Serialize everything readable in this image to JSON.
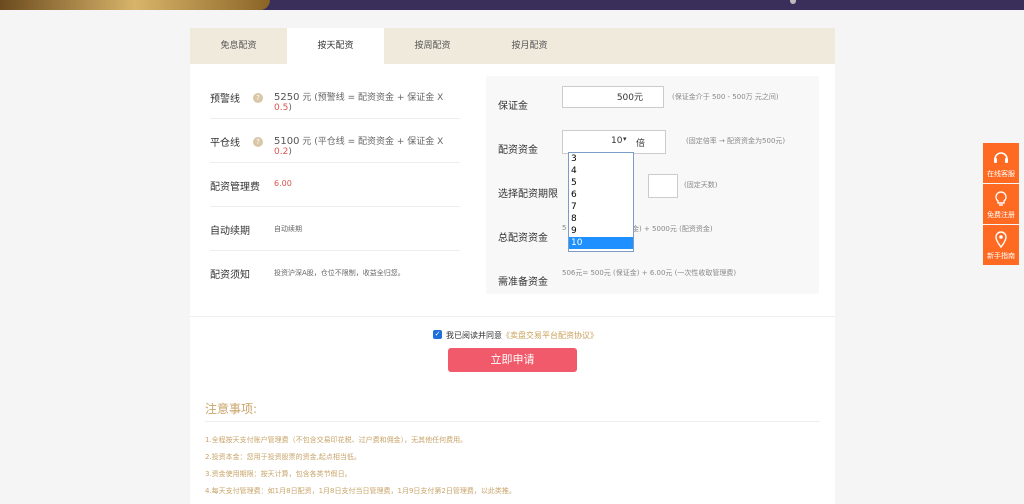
{
  "tabs": [
    {
      "label": "免息配资"
    },
    {
      "label": "按天配资"
    },
    {
      "label": "按周配资"
    },
    {
      "label": "按月配资"
    }
  ],
  "left": {
    "warning": {
      "label": "预警线",
      "value": "5250",
      "unit": "元",
      "formula": "(预警线 = 配资资金 + 保证金 X ",
      "factor": "0.5",
      "close": ")"
    },
    "liquidation": {
      "label": "平仓线",
      "value": "5100",
      "unit": "元",
      "formula": "(平仓线 = 配资资金 + 保证金 X ",
      "factor": "0.2",
      "close": ")"
    },
    "fee": {
      "label": "配资管理费",
      "value": "6.00"
    },
    "renew": {
      "label": "自动续期",
      "value": "自动续期"
    },
    "notice": {
      "label": "配资须知",
      "value": "投资沪深A股，仓位不限制，收益全归您。"
    }
  },
  "right": {
    "deposit": {
      "label": "保证金",
      "value": "500元",
      "hint": "(保证金介于 500 - 500万 元之间)"
    },
    "multiple": {
      "label": "配资资金",
      "value": "10",
      "unit": "倍",
      "hint": "(固定倍率 → 配资资金为500元)"
    },
    "period": {
      "label": "选择配资期限",
      "hint": "(固定天数)"
    },
    "total": {
      "label": "总配资资金",
      "hint_tail": "金) + 5000元 (配资资金)"
    },
    "need": {
      "label": "需准备资金",
      "hint": "506元= 500元 (保证金) + 6.00元 (一次性收取管理费)"
    }
  },
  "dropdown": {
    "options": [
      "3",
      "4",
      "5",
      "6",
      "7",
      "8",
      "9",
      "10"
    ],
    "selected": "10"
  },
  "agree": {
    "text": "我已阅读并同意",
    "link": "《卖盘交易平台配资协议》"
  },
  "apply_label": "立即申请",
  "notice": {
    "title": "注意事项:",
    "items": [
      "1.全程按天支付账户管理费（不包含交易印花税、过户费和佣金），无其他任何费用。",
      "2.投资本金：您用于投资股票的资金,起点相当低。",
      "3.资金使用期限：按天计算，包含各类节假日。",
      "4.每天支付管理费：如1月8日配资，1月8日支付当日管理费，1月9日支付第2日管理费，以此类推。"
    ]
  },
  "sidebar": [
    {
      "label": "在线客服",
      "icon": "headset-icon"
    },
    {
      "label": "免费注册",
      "icon": "lightbulb-icon"
    },
    {
      "label": "新手指南",
      "icon": "location-pin-icon"
    }
  ]
}
